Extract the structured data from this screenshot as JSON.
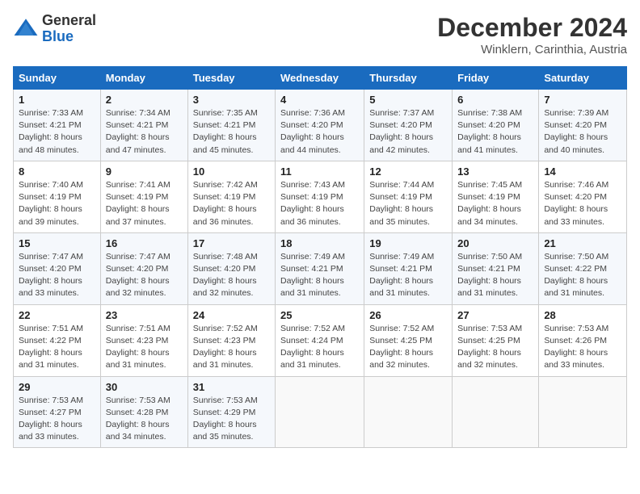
{
  "header": {
    "logo_general": "General",
    "logo_blue": "Blue",
    "month_title": "December 2024",
    "location": "Winklern, Carinthia, Austria"
  },
  "weekdays": [
    "Sunday",
    "Monday",
    "Tuesday",
    "Wednesday",
    "Thursday",
    "Friday",
    "Saturday"
  ],
  "weeks": [
    [
      {
        "day": "1",
        "sunrise": "7:33 AM",
        "sunset": "4:21 PM",
        "daylight": "8 hours and 48 minutes."
      },
      {
        "day": "2",
        "sunrise": "7:34 AM",
        "sunset": "4:21 PM",
        "daylight": "8 hours and 47 minutes."
      },
      {
        "day": "3",
        "sunrise": "7:35 AM",
        "sunset": "4:21 PM",
        "daylight": "8 hours and 45 minutes."
      },
      {
        "day": "4",
        "sunrise": "7:36 AM",
        "sunset": "4:20 PM",
        "daylight": "8 hours and 44 minutes."
      },
      {
        "day": "5",
        "sunrise": "7:37 AM",
        "sunset": "4:20 PM",
        "daylight": "8 hours and 42 minutes."
      },
      {
        "day": "6",
        "sunrise": "7:38 AM",
        "sunset": "4:20 PM",
        "daylight": "8 hours and 41 minutes."
      },
      {
        "day": "7",
        "sunrise": "7:39 AM",
        "sunset": "4:20 PM",
        "daylight": "8 hours and 40 minutes."
      }
    ],
    [
      {
        "day": "8",
        "sunrise": "7:40 AM",
        "sunset": "4:19 PM",
        "daylight": "8 hours and 39 minutes."
      },
      {
        "day": "9",
        "sunrise": "7:41 AM",
        "sunset": "4:19 PM",
        "daylight": "8 hours and 37 minutes."
      },
      {
        "day": "10",
        "sunrise": "7:42 AM",
        "sunset": "4:19 PM",
        "daylight": "8 hours and 36 minutes."
      },
      {
        "day": "11",
        "sunrise": "7:43 AM",
        "sunset": "4:19 PM",
        "daylight": "8 hours and 36 minutes."
      },
      {
        "day": "12",
        "sunrise": "7:44 AM",
        "sunset": "4:19 PM",
        "daylight": "8 hours and 35 minutes."
      },
      {
        "day": "13",
        "sunrise": "7:45 AM",
        "sunset": "4:19 PM",
        "daylight": "8 hours and 34 minutes."
      },
      {
        "day": "14",
        "sunrise": "7:46 AM",
        "sunset": "4:20 PM",
        "daylight": "8 hours and 33 minutes."
      }
    ],
    [
      {
        "day": "15",
        "sunrise": "7:47 AM",
        "sunset": "4:20 PM",
        "daylight": "8 hours and 33 minutes."
      },
      {
        "day": "16",
        "sunrise": "7:47 AM",
        "sunset": "4:20 PM",
        "daylight": "8 hours and 32 minutes."
      },
      {
        "day": "17",
        "sunrise": "7:48 AM",
        "sunset": "4:20 PM",
        "daylight": "8 hours and 32 minutes."
      },
      {
        "day": "18",
        "sunrise": "7:49 AM",
        "sunset": "4:21 PM",
        "daylight": "8 hours and 31 minutes."
      },
      {
        "day": "19",
        "sunrise": "7:49 AM",
        "sunset": "4:21 PM",
        "daylight": "8 hours and 31 minutes."
      },
      {
        "day": "20",
        "sunrise": "7:50 AM",
        "sunset": "4:21 PM",
        "daylight": "8 hours and 31 minutes."
      },
      {
        "day": "21",
        "sunrise": "7:50 AM",
        "sunset": "4:22 PM",
        "daylight": "8 hours and 31 minutes."
      }
    ],
    [
      {
        "day": "22",
        "sunrise": "7:51 AM",
        "sunset": "4:22 PM",
        "daylight": "8 hours and 31 minutes."
      },
      {
        "day": "23",
        "sunrise": "7:51 AM",
        "sunset": "4:23 PM",
        "daylight": "8 hours and 31 minutes."
      },
      {
        "day": "24",
        "sunrise": "7:52 AM",
        "sunset": "4:23 PM",
        "daylight": "8 hours and 31 minutes."
      },
      {
        "day": "25",
        "sunrise": "7:52 AM",
        "sunset": "4:24 PM",
        "daylight": "8 hours and 31 minutes."
      },
      {
        "day": "26",
        "sunrise": "7:52 AM",
        "sunset": "4:25 PM",
        "daylight": "8 hours and 32 minutes."
      },
      {
        "day": "27",
        "sunrise": "7:53 AM",
        "sunset": "4:25 PM",
        "daylight": "8 hours and 32 minutes."
      },
      {
        "day": "28",
        "sunrise": "7:53 AM",
        "sunset": "4:26 PM",
        "daylight": "8 hours and 33 minutes."
      }
    ],
    [
      {
        "day": "29",
        "sunrise": "7:53 AM",
        "sunset": "4:27 PM",
        "daylight": "8 hours and 33 minutes."
      },
      {
        "day": "30",
        "sunrise": "7:53 AM",
        "sunset": "4:28 PM",
        "daylight": "8 hours and 34 minutes."
      },
      {
        "day": "31",
        "sunrise": "7:53 AM",
        "sunset": "4:29 PM",
        "daylight": "8 hours and 35 minutes."
      },
      null,
      null,
      null,
      null
    ]
  ],
  "labels": {
    "sunrise": "Sunrise:",
    "sunset": "Sunset:",
    "daylight": "Daylight:"
  }
}
